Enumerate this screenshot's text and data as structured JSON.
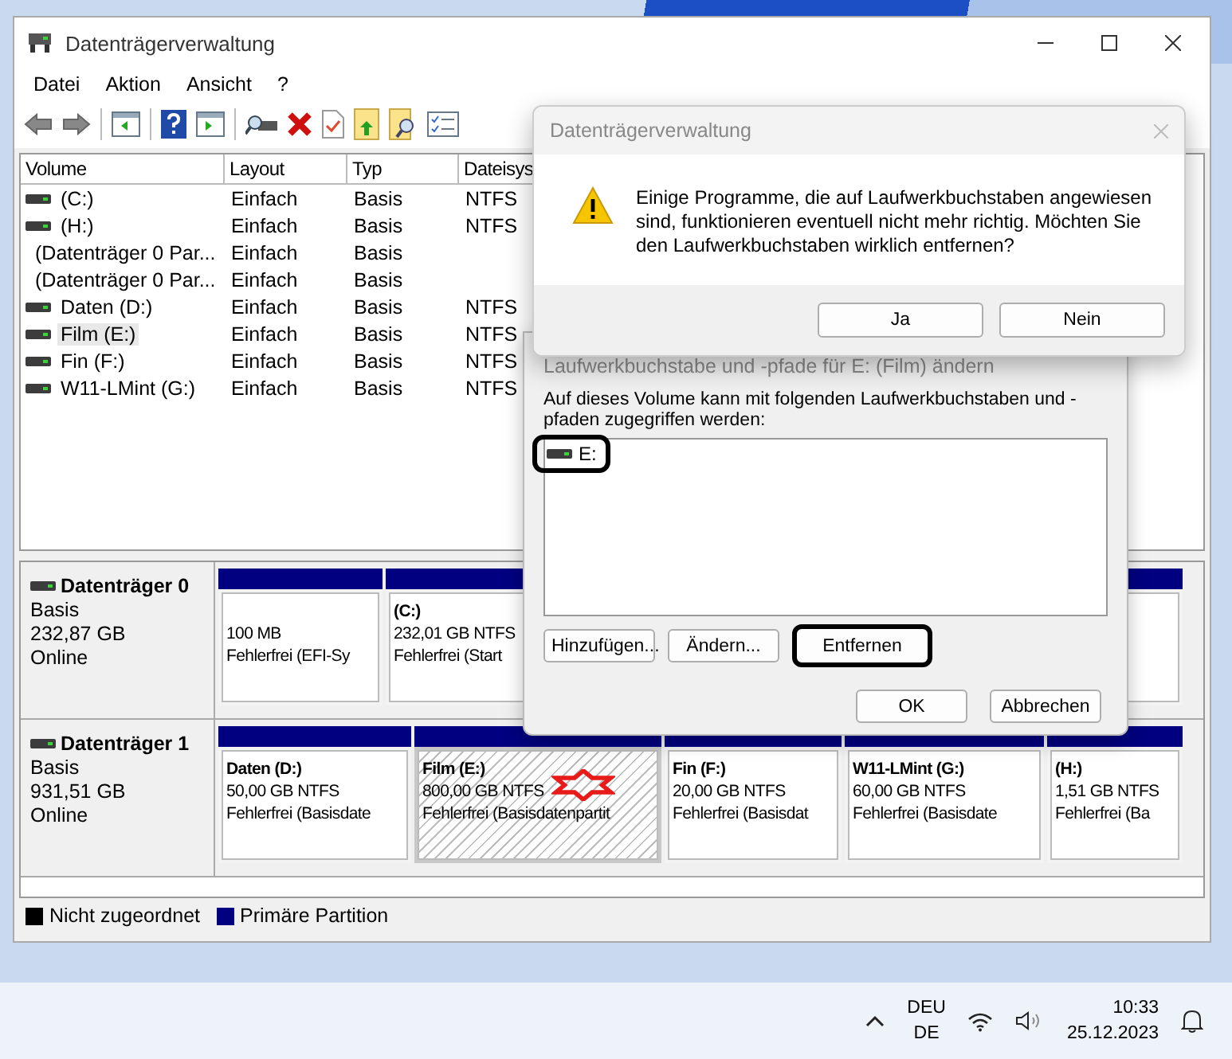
{
  "window": {
    "title": "Datenträgerverwaltung"
  },
  "menu": [
    "Datei",
    "Aktion",
    "Ansicht",
    "?"
  ],
  "volume_table": {
    "columns": [
      "Volume",
      "Layout",
      "Typ",
      "Dateisys"
    ],
    "rows": [
      {
        "cells": [
          "(C:)",
          "Einfach",
          "Basis",
          "NTFS"
        ],
        "selected": false
      },
      {
        "cells": [
          "(H:)",
          "Einfach",
          "Basis",
          "NTFS"
        ],
        "selected": false
      },
      {
        "cells": [
          "(Datenträger 0 Par...",
          "Einfach",
          "Basis",
          ""
        ],
        "selected": false
      },
      {
        "cells": [
          "(Datenträger 0 Par...",
          "Einfach",
          "Basis",
          ""
        ],
        "selected": false
      },
      {
        "cells": [
          "Daten (D:)",
          "Einfach",
          "Basis",
          "NTFS"
        ],
        "selected": false
      },
      {
        "cells": [
          "Film (E:)",
          "Einfach",
          "Basis",
          "NTFS"
        ],
        "selected": true
      },
      {
        "cells": [
          "Fin (F:)",
          "Einfach",
          "Basis",
          "NTFS"
        ],
        "selected": false
      },
      {
        "cells": [
          "W11-LMint (G:)",
          "Einfach",
          "Basis",
          "NTFS"
        ],
        "selected": false
      }
    ]
  },
  "disks": [
    {
      "name": "Datenträger 0",
      "type": "Basis",
      "size": "232,87 GB",
      "status": "Online",
      "partitions": [
        {
          "size": "100 MB",
          "status": "Fehlerfrei (EFI-Sy",
          "selected": false,
          "marked": false
        },
        {
          "label": "(C:)",
          "size": "232,01 GB NTFS",
          "status": "Fehlerfrei (Start",
          "selected": false,
          "marked": false
        }
      ]
    },
    {
      "name": "Datenträger 1",
      "type": "Basis",
      "size": "931,51 GB",
      "status": "Online",
      "partitions": [
        {
          "label": "Daten  (D:)",
          "size": "50,00 GB NTFS",
          "status": "Fehlerfrei (Basisdate",
          "selected": false,
          "marked": false
        },
        {
          "label": "Film  (E:)",
          "size": "800,00 GB NTFS",
          "status": "Fehlerfrei (Basisdatenpartit",
          "selected": true,
          "marked": true
        },
        {
          "label": "Fin  (F:)",
          "size": "20,00 GB NTFS",
          "status": "Fehlerfrei (Basisdat",
          "selected": false,
          "marked": false
        },
        {
          "label": "W11-LMint  (G:)",
          "size": "60,00 GB NTFS",
          "status": "Fehlerfrei (Basisdate",
          "selected": false,
          "marked": false
        },
        {
          "label": "(H:)",
          "size": "1,51 GB NTFS",
          "status": "Fehlerfrei (Ba",
          "selected": false,
          "marked": false
        }
      ]
    }
  ],
  "legend": [
    {
      "label": "Nicht zugeordnet",
      "color": "#000000"
    },
    {
      "label": "Primäre Partition",
      "color": "#000080"
    }
  ],
  "letter_dialog": {
    "title": "Laufwerkbuchstabe und -pfade für E: (Film) ändern",
    "prompt": "Auf dieses Volume kann mit folgenden Laufwerkbuchstaben und -pfaden zugegriffen werden:",
    "paths": [
      {
        "label": "E:",
        "highlighted": true
      }
    ],
    "buttons": [
      {
        "label": "Hinzufügen...",
        "highlighted": false
      },
      {
        "label": "Ändern...",
        "highlighted": false
      },
      {
        "label": "Entfernen",
        "highlighted": true
      }
    ],
    "footer_buttons": [
      "OK",
      "Abbrechen"
    ]
  },
  "confirm_dialog": {
    "title": "Datenträgerverwaltung",
    "message": "Einige Programme, die auf Laufwerkbuchstaben angewiesen sind, funktionieren eventuell nicht mehr richtig. Möchten Sie den Laufwerkbuchstaben wirklich entfernen?",
    "buttons": [
      "Ja",
      "Nein"
    ]
  },
  "taskbar": {
    "language": [
      "DEU",
      "DE"
    ],
    "time": "10:33",
    "date": "25.12.2023"
  }
}
